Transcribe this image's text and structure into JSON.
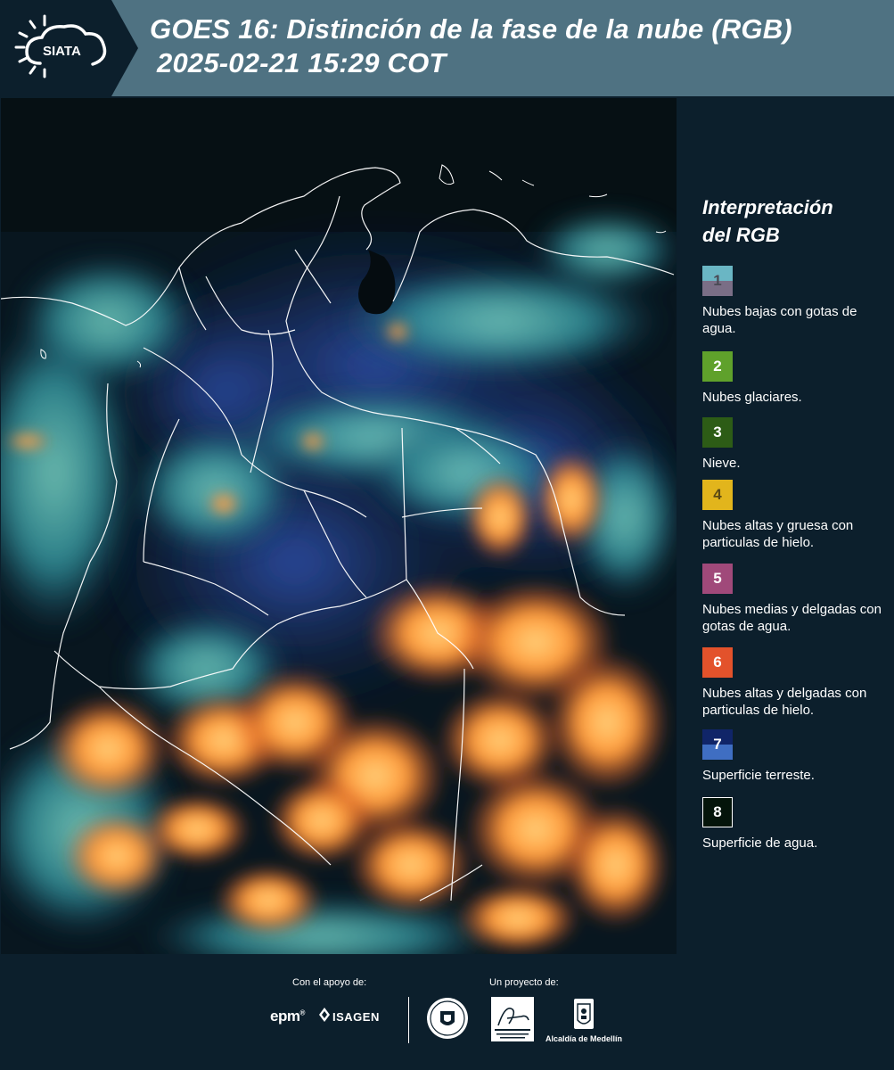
{
  "header": {
    "brand": "SIATA",
    "title_line1": "GOES 16: Distinción de la fase de la nube (RGB)",
    "title_line2": "2025-02-21 15:29 COT"
  },
  "legend": {
    "title_line1": "Interpretación",
    "title_line2": "del RGB",
    "items": [
      {
        "number": "1",
        "label": "Nubes bajas con gotas de agua.",
        "colors": [
          "#6ab6c4",
          "#7a6e86"
        ]
      },
      {
        "number": "2",
        "label": "Nubes glaciares.",
        "colors": [
          "#5fa12b"
        ]
      },
      {
        "number": "3",
        "label": "Nieve.",
        "colors": [
          "#2d5c16"
        ]
      },
      {
        "number": "4",
        "label": "Nubes altas y gruesa con particulas de hielo.",
        "colors": [
          "#e2b51c"
        ]
      },
      {
        "number": "5",
        "label": "Nubes medias y delgadas con gotas de agua.",
        "colors": [
          "#a0497a"
        ]
      },
      {
        "number": "6",
        "label": "Nubes altas y delgadas con particulas de hielo.",
        "colors": [
          "#e3522b"
        ]
      },
      {
        "number": "7",
        "label": "Superficie terreste.",
        "colors": [
          "#102568",
          "#3f6ec2"
        ]
      },
      {
        "number": "8",
        "label": "Superficie de agua.",
        "colors": [
          "#04140a"
        ]
      }
    ]
  },
  "footer": {
    "support_label": "Con el apoyo de:",
    "project_label": "Un proyecto de:",
    "sponsor_epm": "epm",
    "sponsor_isagen": "ISAGEN",
    "partner_alcaldia": "Alcaldía de Medellín"
  }
}
